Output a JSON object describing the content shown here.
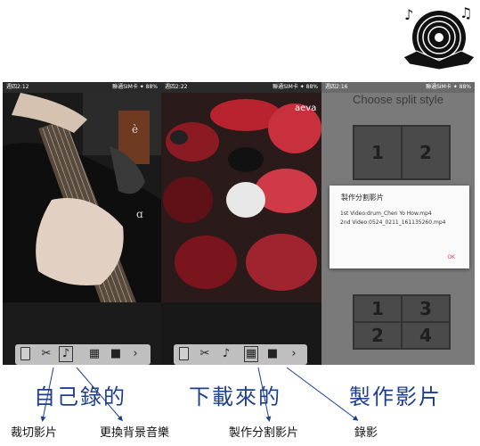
{
  "screens": [
    {
      "status_left": "週四2:12",
      "status_right": "聯通SIM卡 ✦ 88%"
    },
    {
      "status_left": "週四2:22",
      "status_right": "聯通SIM卡 ✦ 88%"
    },
    {
      "status_left": "週四2:16",
      "status_right": "聯通SIM卡 ✦ 88%"
    }
  ],
  "split_style": {
    "title": "Choose split style",
    "two_split": [
      "1",
      "2"
    ],
    "four_split": [
      "1",
      "3",
      "2",
      "4"
    ]
  },
  "dialog": {
    "title": "製作分割影片",
    "line1": "1st Video:drum_Chen Yo How.mp4",
    "line2": "2nd Video:0524_0211_161135260.mp4",
    "ok": "OK"
  },
  "annotations": {
    "self_recorded": "自己錄的",
    "downloaded": "下載來的",
    "make_video": "製作影片",
    "crop_video": "裁切影片",
    "change_bgm": "更換背景音樂",
    "make_split_video": "製作分割影片",
    "record_video": "錄影"
  },
  "toolbar_icons": [
    "document-icon",
    "crop-icon",
    "music-icon",
    "grid-icon",
    "camera-icon",
    "chevron-right-icon"
  ],
  "colors": {
    "annotation_blue": "#1e3f8e",
    "ok_red": "#e0405a"
  }
}
